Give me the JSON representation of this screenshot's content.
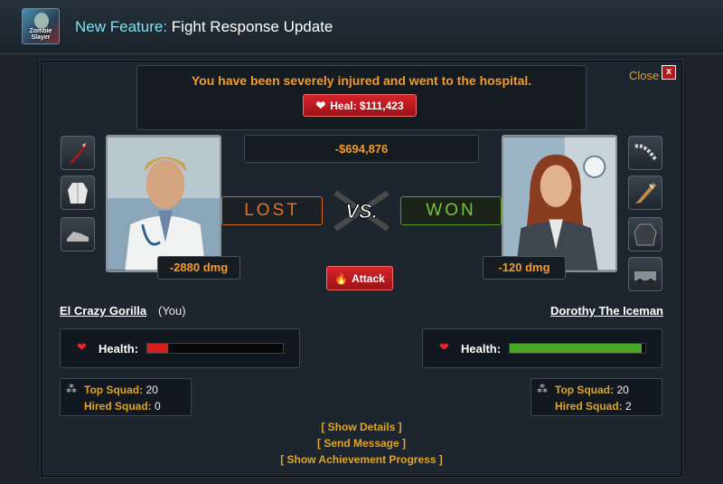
{
  "header": {
    "logo_alt": "Zombie Slayer",
    "title_prefix": "New Feature:",
    "title_main": "Fight Response Update"
  },
  "notice": {
    "message": "You have been severely injured and went to the hospital.",
    "heal_label": "Heal: $111,423"
  },
  "close_label": "Close",
  "close_x": "x",
  "money_change": "-$694,876",
  "player": {
    "name": "El Crazy Gorilla",
    "you_tag": "(You)",
    "damage": "-2880 dmg",
    "result": "LOST",
    "health_label": "Health:",
    "health_fraction": 0.15,
    "health_color": "#d81f1f",
    "top_squad_label": "Top Squad:",
    "top_squad_value": "20",
    "hired_squad_label": "Hired Squad:",
    "hired_squad_value": "0",
    "equipment": [
      "knife-icon",
      "labcoat-icon",
      "shoes-icon"
    ]
  },
  "opponent": {
    "name": "Dorothy The Iceman",
    "damage": "-120 dmg",
    "result": "WON",
    "health_label": "Health:",
    "health_fraction": 0.97,
    "health_color": "#47a622",
    "top_squad_label": "Top Squad:",
    "top_squad_value": "20",
    "hired_squad_label": "Hired Squad:",
    "hired_squad_value": "2",
    "equipment": [
      "chain-icon",
      "bat-icon",
      "jacket-icon",
      "vehicle-icon"
    ]
  },
  "attack_label": "Attack",
  "links": {
    "show_details": "[ Show Details ]",
    "send_message": "[ Send Message ]",
    "show_achievement": "[ Show Achievement Progress ]"
  },
  "colors": {
    "accent_orange": "#f39a2a",
    "accent_gold": "#e0a525",
    "button_red": "#c81d23"
  }
}
